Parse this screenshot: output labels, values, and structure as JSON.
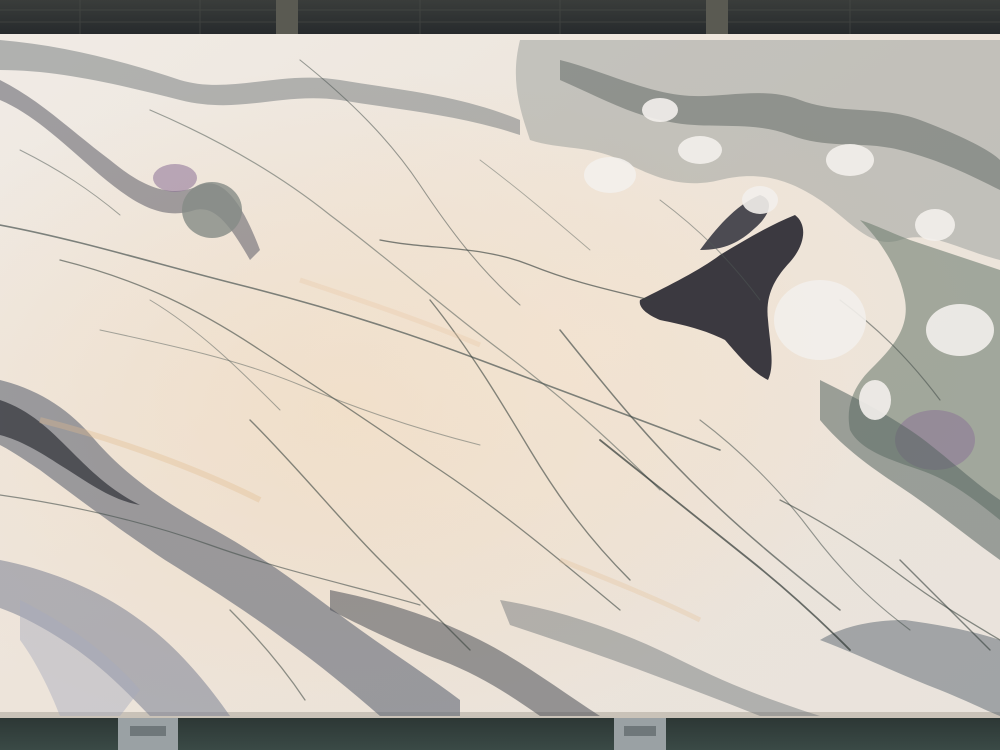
{
  "scene": {
    "subject": "polished-marble-slab",
    "colors": {
      "backdrop_top": "#3a3d3b",
      "backdrop_bottom": "#23272a",
      "beam": "#5a5a52",
      "floor": "#2f3a38",
      "marble_base": "#ece6de",
      "marble_warm": "#efd9c0",
      "vein_dark": "#2b2a33",
      "vein_grey": "#7b8284",
      "vein_green": "#6f7f72",
      "vein_violet": "#8a6f96",
      "slab_edge": "#c9c2b8",
      "stand": "#9aa1a4"
    }
  }
}
